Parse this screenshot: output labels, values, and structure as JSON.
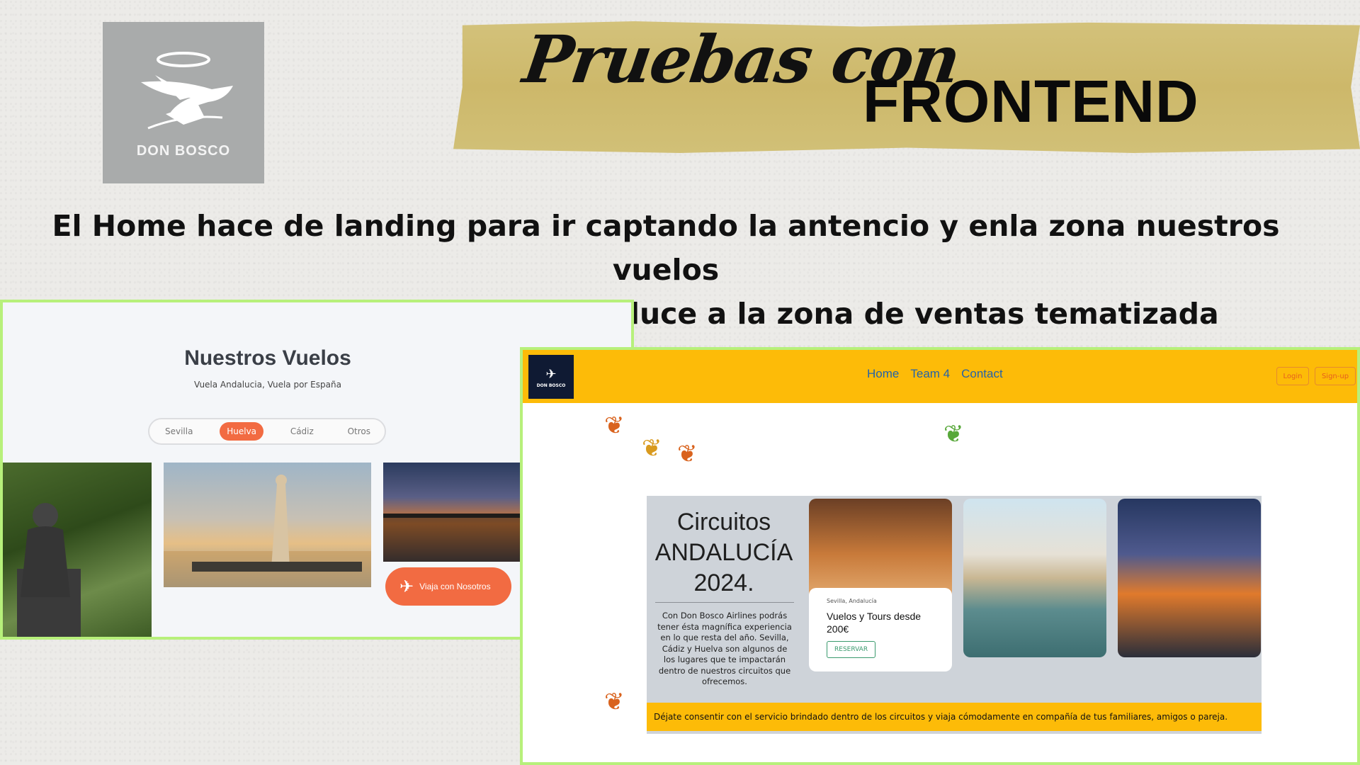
{
  "banner": {
    "logo_text": "DON BOSCO",
    "script_title": "Pruebas con",
    "main_title": "FRONTEND"
  },
  "headline": {
    "line1": "El Home hace de landing para ir captando la antencio y enla zona nuestros vuelos",
    "line2": "un gran botón naranja que conduce a la zona de ventas tematizada"
  },
  "left_screenshot": {
    "title": "Nuestros Vuelos",
    "subtitle": "Vuela Andalucia, Vuela por España",
    "filters": [
      "Sevilla",
      "Huelva",
      "Cádiz",
      "Otros"
    ],
    "active_filter": "Huelva",
    "cta_label": "Viaja con Nosotros",
    "colors": {
      "accent": "#f26b42",
      "border": "#b7f07b"
    }
  },
  "right_screenshot": {
    "logo_text": "DON BOSCO",
    "nav_links": [
      "Home",
      "Team 4",
      "Contact"
    ],
    "login_label": "Login",
    "signup_label": "Sign-up",
    "heading_line1": "Circuitos",
    "heading_line2": "ANDALUCÍA",
    "heading_line3": "2024.",
    "description": "Con Don Bosco Airlines podrás tener ésta magnífica experiencia en lo que resta del año. Sevilla, Cádiz y Huelva son algunos de los lugares que te impactarán dentro de nuestros circuitos que ofrecemos.",
    "card": {
      "location": "Sevilla, Andalucía",
      "text": "Vuelos y Tours desde 200€",
      "button": "RESERVAR"
    },
    "strip_text": "Déjate consentir con el servicio brindado dentro de los circuitos y viaja cómodamente en compañía de tus familiares, amigos o pareja.",
    "colors": {
      "nav": "#fdbb08",
      "link": "#2563a8"
    }
  }
}
